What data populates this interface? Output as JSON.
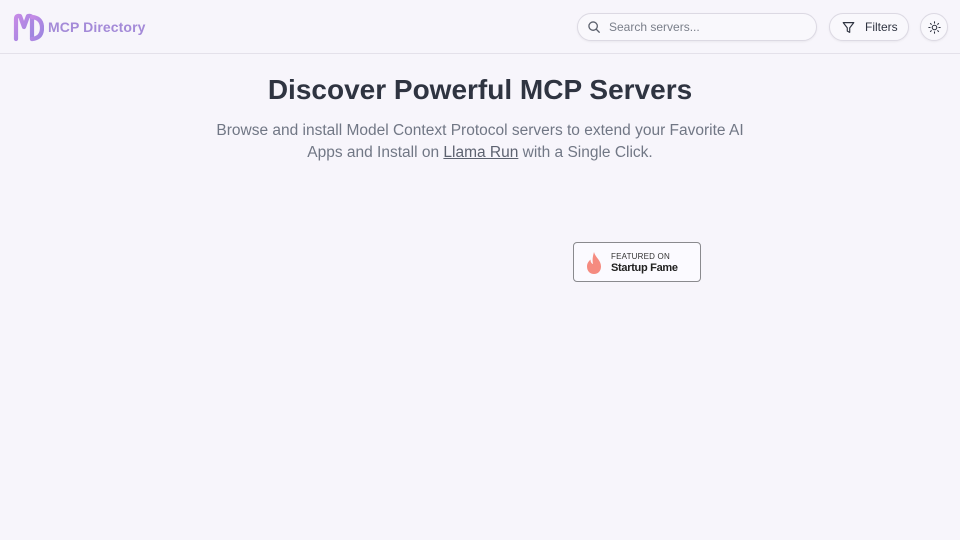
{
  "header": {
    "brand_name": "MCP Directory",
    "brand_logo_icon": "md-logo-icon",
    "search": {
      "placeholder": "Search servers...",
      "value": "",
      "icon": "search-icon"
    },
    "filters_label": "Filters",
    "filters_icon": "filter-funnel-icon",
    "theme_toggle_icon": "sun-icon"
  },
  "hero": {
    "title": "Discover Powerful MCP Servers",
    "subtitle_before_link": "Browse and install Model Context Protocol servers to extend your Favorite AI Apps and Install on ",
    "subtitle_link": "Llama Run",
    "subtitle_after_link": " with a Single Click."
  },
  "badge": {
    "top_text": "FEATURED ON",
    "main_text": "Startup Fame",
    "icon": "flame-icon"
  },
  "colors": {
    "background": "#f7f5fb",
    "brand": "#a48ad8",
    "title": "#2f3441",
    "subtitle": "#717785",
    "flame": "#f58b80"
  }
}
